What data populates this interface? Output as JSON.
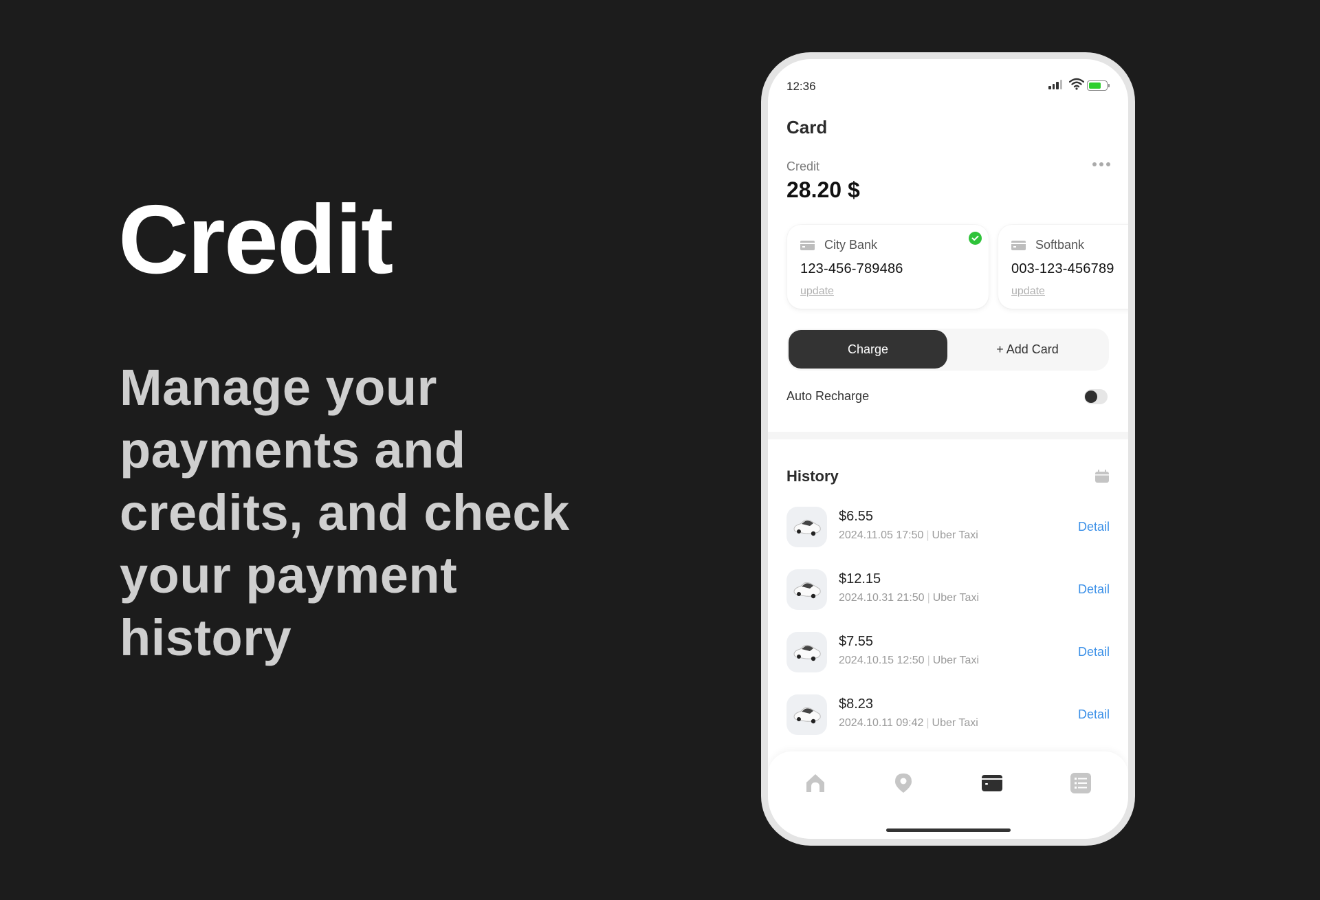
{
  "hero": {
    "title": "Credit",
    "subtitle": "Manage your payments and credits, and check your payment history"
  },
  "status_bar": {
    "time": "12:36",
    "signal_icon": "cellular-signal-icon",
    "wifi_icon": "wifi-icon",
    "battery_icon": "battery-icon",
    "battery_color": "#2fcf2f"
  },
  "screen": {
    "title": "Card",
    "credit_label": "Credit",
    "credit_value": "28.20 $",
    "more_icon": "more-horizontal-icon"
  },
  "cards": [
    {
      "bank": "City Bank",
      "number": "123-456-789486",
      "action": "update",
      "selected": true,
      "icon": "credit-card-icon"
    },
    {
      "bank": "Softbank",
      "number": "003-123-456789",
      "action": "update",
      "selected": false,
      "icon": "credit-card-icon"
    }
  ],
  "actions": {
    "charge_label": "Charge",
    "add_card_label": "+ Add Card",
    "active": "Charge"
  },
  "auto_recharge": {
    "label": "Auto Recharge",
    "enabled": false
  },
  "history": {
    "title": "History",
    "calendar_icon": "calendar-icon",
    "items": [
      {
        "amount": "$6.55",
        "datetime": "2024.11.05 17:50",
        "service": "Uber Taxi",
        "detail_label": "Detail",
        "icon": "car-icon"
      },
      {
        "amount": "$12.15",
        "datetime": "2024.10.31 21:50",
        "service": "Uber Taxi",
        "detail_label": "Detail",
        "icon": "car-icon"
      },
      {
        "amount": "$7.55",
        "datetime": "2024.10.15 12:50",
        "service": "Uber Taxi",
        "detail_label": "Detail",
        "icon": "car-icon"
      },
      {
        "amount": "$8.23",
        "datetime": "2024.10.11 09:42",
        "service": "Uber Taxi",
        "detail_label": "Detail",
        "icon": "car-icon"
      }
    ]
  },
  "tabbar": {
    "items": [
      {
        "name": "home",
        "icon": "home-icon",
        "active": false
      },
      {
        "name": "location",
        "icon": "map-pin-icon",
        "active": false
      },
      {
        "name": "card",
        "icon": "credit-card-icon",
        "active": true
      },
      {
        "name": "list",
        "icon": "list-icon",
        "active": false
      }
    ]
  },
  "colors": {
    "background": "#1c1c1c",
    "accent_dark": "#333333",
    "link_blue": "#3b90e8",
    "success_green": "#2fc33a"
  }
}
